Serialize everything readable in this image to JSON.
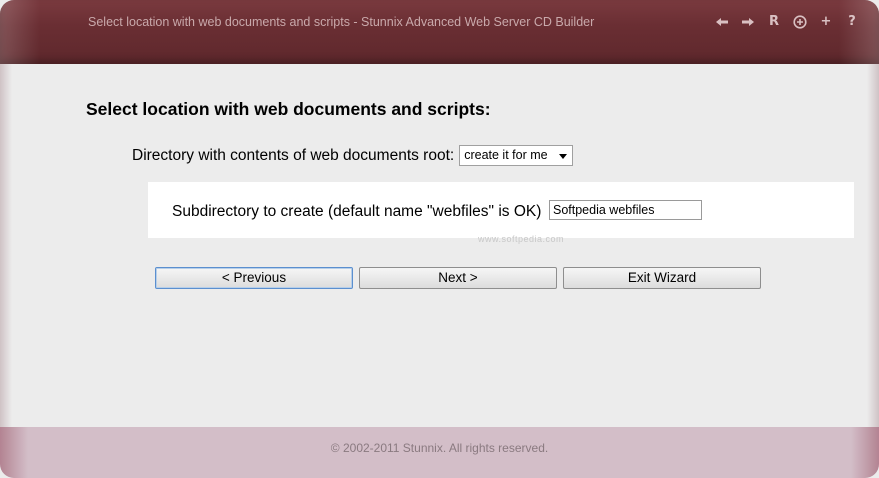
{
  "window": {
    "title": "Select location with web documents and scripts - Stunnix Advanced Web Server CD Builder",
    "toolbar_icons": [
      {
        "name": "back-arrow-icon",
        "glyph": ""
      },
      {
        "name": "forward-arrow-icon",
        "glyph": ""
      },
      {
        "name": "reload-icon",
        "glyph": "R"
      },
      {
        "name": "zoom-in-icon",
        "glyph": ""
      },
      {
        "name": "plus-icon",
        "glyph": "+"
      },
      {
        "name": "help-icon",
        "glyph": "?"
      }
    ]
  },
  "main": {
    "heading": "Select location with web documents and scripts:",
    "directory_label": "Directory with contents of web documents root:",
    "directory_select_value": "create it for me",
    "subdirectory_label": "Subdirectory to create (default name \"webfiles\" is OK)",
    "subdirectory_value": "Softpedia webfiles",
    "watermark": "www.softpedia.com"
  },
  "buttons": {
    "previous": "< Previous",
    "next": "Next >",
    "exit": "Exit Wizard"
  },
  "footer": {
    "copyright": "© 2002-2011 Stunnix. All rights reserved."
  },
  "colors": {
    "titlebar": "#6a2e33",
    "footer": "#d3bec8",
    "content_bg": "#ececec",
    "focus_border": "#5b8fcf"
  }
}
